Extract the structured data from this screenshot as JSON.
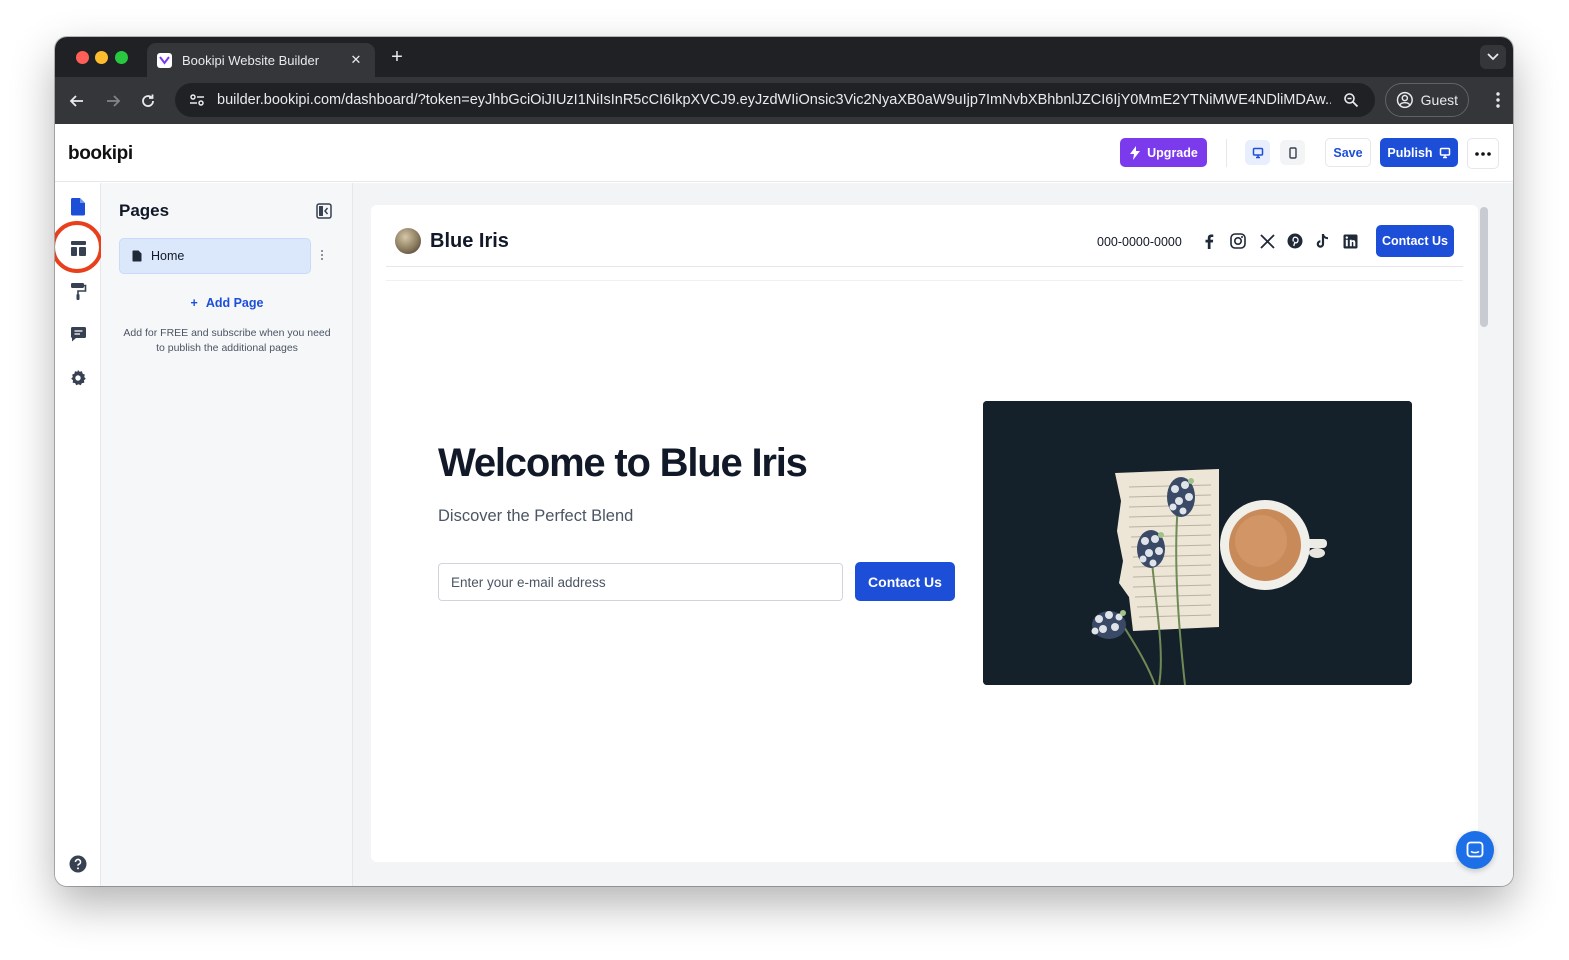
{
  "browser": {
    "tab_title": "Bookipi Website Builder",
    "url": "builder.bookipi.com/dashboard/?token=eyJhbGciOiJIUzI1NiIsInR5cCI6IkpXVCJ9.eyJzdWIiOnsic3Vic2NyaXB0aW9uIjp7ImNvbXBhbnlJZCI6IjY0MmE2YTNiMWE4NDliMDAw...",
    "profile_label": "Guest"
  },
  "app": {
    "logo": "bookipi",
    "upgrade_label": "Upgrade",
    "save_label": "Save",
    "publish_label": "Publish"
  },
  "pages_panel": {
    "title": "Pages",
    "items": [
      {
        "label": "Home"
      }
    ],
    "add_page_label": "Add Page",
    "add_page_note": "Add for FREE and subscribe when you need to publish the additional pages"
  },
  "site": {
    "name": "Blue Iris",
    "phone": "000-0000-0000",
    "header_contact_label": "Contact Us",
    "hero_title": "Welcome to Blue Iris",
    "hero_subtitle": "Discover the Perfect Blend",
    "email_placeholder": "Enter your e-mail address",
    "hero_contact_label": "Contact Us"
  },
  "colors": {
    "primary": "#1d4ed8",
    "upgrade": "#7c3aed",
    "highlight": "#e8401c"
  }
}
